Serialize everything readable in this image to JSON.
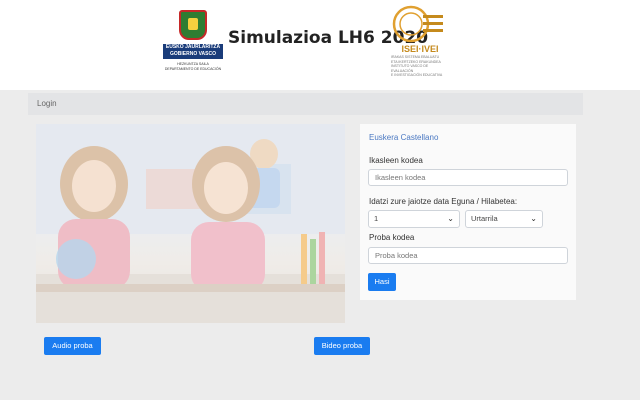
{
  "header": {
    "title": "Simulazioa LH6 2020",
    "gov_logo": {
      "line1": "EUSKO JAURLARITZA",
      "line2": "GOBIERNO VASCO",
      "sub1": "HEZKUNTZA SAILA",
      "sub2": "DEPARTAMENTO DE EDUCACIÓN"
    },
    "isei_logo": {
      "name": "ISEI·IVEI",
      "sub1": "IRAKAS SISTEMA EBALUATU",
      "sub2": "ETA IKERTZEKO ERAKUNDEA",
      "sub3": "INSTITUTO VASCO DE EVALUACIÓN",
      "sub4": "E INVESTIGACIÓN EDUCATIVA"
    }
  },
  "band": {
    "label": "Login"
  },
  "form": {
    "lang_eu": "Euskera",
    "lang_es": "Castellano",
    "student_label": "Ikasleen kodea",
    "student_placeholder": "Ikasleen kodea",
    "birth_label": "Idatzi zure jaiotze data Eguna / Hilabetea:",
    "day_value": "1",
    "month_value": "Urtarrila",
    "test_label": "Proba kodea",
    "test_placeholder": "Proba kodea",
    "submit_label": "Hasi"
  },
  "buttons": {
    "audio_label": "Audio proba",
    "video_label": "Bideo proba"
  },
  "icons": {
    "dropdown": "chevron-down-icon"
  },
  "colors": {
    "primary": "#1a7cf0",
    "link": "#4a78c2",
    "band": "#e3e4e6"
  }
}
